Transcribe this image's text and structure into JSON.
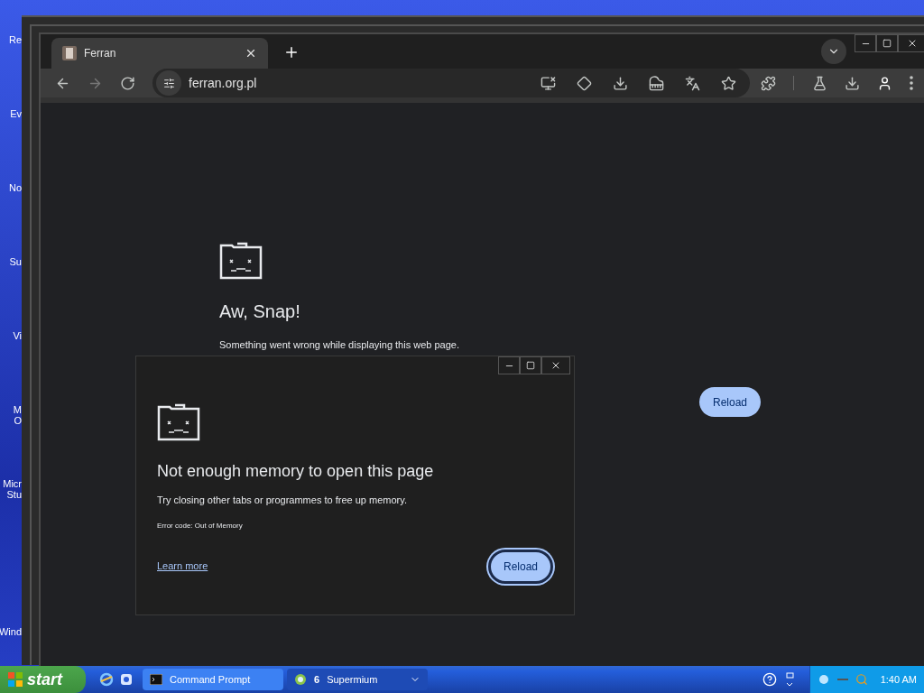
{
  "desktop": {
    "icons": [
      {
        "lines": [
          "Re"
        ]
      },
      {
        "lines": [
          "Ev"
        ]
      },
      {
        "lines": [
          "No"
        ]
      },
      {
        "lines": [
          "Su"
        ]
      },
      {
        "lines": [
          "Vi"
        ]
      },
      {
        "lines": [
          "M",
          "O"
        ]
      },
      {
        "lines": [
          "Micr",
          "Stu"
        ]
      },
      {
        "lines": [
          "Wind"
        ]
      }
    ]
  },
  "browser": {
    "tabs": [
      {
        "title": "Ferran",
        "selected": true
      }
    ],
    "address": "ferran.org.pl",
    "page": {
      "title": "Aw, Snap!",
      "message": "Something went wrong while displaying this web page.",
      "reload_button": "Reload"
    },
    "dialog": {
      "title": "Not enough memory to open this page",
      "message": "Try closing other tabs or programmes to free up memory.",
      "error_code": "Error code: Out of Memory",
      "link": "Learn more",
      "reload_button": "Reload",
      "focused": true
    }
  },
  "taskbar": {
    "start": "start",
    "tasks": [
      {
        "label": "Command Prompt",
        "kind": "console",
        "selected": false
      },
      {
        "count": "6",
        "label": "Supermium",
        "kind": "browser",
        "selected": true
      }
    ],
    "clock": "1:40 AM"
  }
}
